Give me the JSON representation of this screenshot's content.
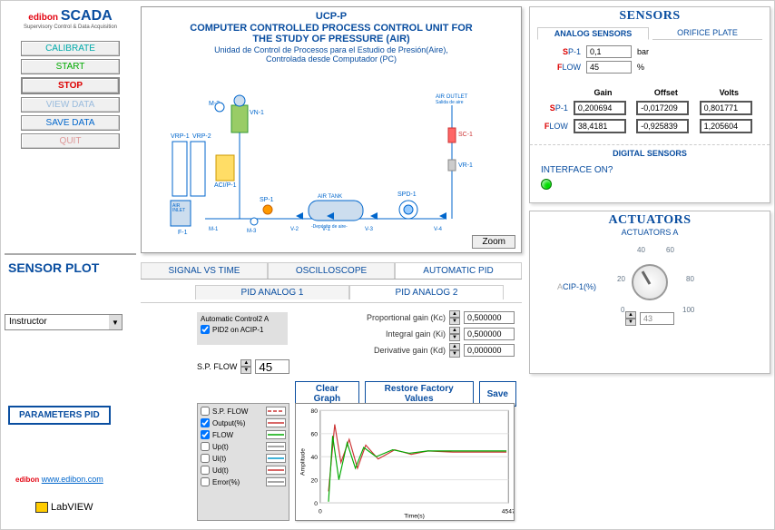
{
  "logo": {
    "prefix": "edibon",
    "main": "SCADA",
    "sub": "Supervisory Control & Data Acquisition"
  },
  "buttons": {
    "calibrate": "CALIBRATE",
    "start": "START",
    "stop": "STOP",
    "view": "VIEW DATA",
    "save": "SAVE DATA",
    "quit": "QUIT"
  },
  "sensor_plot_hdr": "SENSOR PLOT",
  "instructor": {
    "label": "Instructor"
  },
  "parameters_btn": "PARAMETERS PID",
  "website": {
    "prefix": "edibon",
    "url": "www.edibon.com"
  },
  "labview": "LabVIEW",
  "diagram": {
    "title1": "UCP-P",
    "title2": "COMPUTER CONTROLLED PROCESS CONTROL UNIT FOR",
    "title3": "THE STUDY OF PRESSURE (AIR)",
    "title4": "Unidad de Control de Procesos para el Estudio de Presión(Aire),",
    "title5": "Controlada desde Computador (PC)",
    "zoom": "Zoom",
    "labels": {
      "vrp1": "VRP-1",
      "vrp2": "VRP-2",
      "m2": "M-2",
      "vn1": "VN-1",
      "acip1": "ACI/P-1",
      "airinlet": "AIR\nINLET\nEntrada\nde Aire",
      "f1": "F-1",
      "m1": "M-1",
      "sp1": "SP-1",
      "m3": "M-3",
      "airtank": "AIR TANK\n-Depósito de aire-",
      "spd1": "SPD-1",
      "v1": "V-1",
      "v2": "V-2",
      "v3": "V-3",
      "v4": "V-4",
      "airoutlet": "AIR OUTLET\nSalida de aire",
      "sc1": "SC-1",
      "vr1": "VR-1"
    }
  },
  "mid_tabs": {
    "signal": "SIGNAL VS TIME",
    "osc": "OSCILLOSCOPE",
    "auto": "AUTOMATIC PID"
  },
  "sub_tabs": {
    "p1": "PID ANALOG 1",
    "p2": "PID ANALOG 2"
  },
  "auto_box": {
    "hdr": "Automatic Control2 A",
    "check": "PID2 on ACIP-1"
  },
  "sp_flow": {
    "label": "S.P. FLOW",
    "value": "45"
  },
  "gains": {
    "kc": {
      "label": "Proportional gain (Kc)",
      "value": "0,500000",
      "color": "#d00"
    },
    "ki": {
      "label": "Integral gain (Ki)",
      "value": "0,500000",
      "color": "#d00"
    },
    "kd": {
      "label": "Derivative gain (Kd)",
      "value": "0,000000",
      "color": "#d00"
    }
  },
  "pid_btns": {
    "clear": "Clear Graph",
    "restore": "Restore Factory Values",
    "save": "Save"
  },
  "legend": [
    {
      "name": "S.P. FLOW",
      "checked": false,
      "dash": "4,2",
      "color": "#c33"
    },
    {
      "name": "Output(%)",
      "checked": true,
      "dash": "",
      "color": "#c33"
    },
    {
      "name": "FLOW",
      "checked": true,
      "dash": "",
      "color": "#0a0"
    },
    {
      "name": "Up(t)",
      "checked": false,
      "dash": "",
      "color": "#888"
    },
    {
      "name": "Ui(t)",
      "checked": false,
      "dash": "",
      "color": "#09c"
    },
    {
      "name": "Ud(t)",
      "checked": false,
      "dash": "",
      "color": "#c33"
    },
    {
      "name": "Error(%)",
      "checked": false,
      "dash": "",
      "color": "#888"
    }
  ],
  "chart_data": {
    "type": "line",
    "title": "",
    "xlabel": "Time(s)",
    "ylabel": "Amplitude",
    "xlim": [
      0,
      4547
    ],
    "ylim": [
      0,
      80
    ],
    "xticks": [
      0,
      4547
    ],
    "yticks": [
      0,
      20,
      40,
      60,
      80
    ],
    "series": [
      {
        "name": "Output(%)",
        "color": "#c33",
        "x": [
          200,
          350,
          500,
          700,
          900,
          1100,
          1400,
          1800,
          2200,
          2600,
          3200,
          3800,
          4500
        ],
        "y": [
          10,
          68,
          35,
          55,
          30,
          50,
          38,
          46,
          42,
          45,
          44,
          44,
          44
        ]
      },
      {
        "name": "FLOW",
        "color": "#0a0",
        "x": [
          200,
          300,
          450,
          650,
          850,
          1050,
          1350,
          1750,
          2150,
          2600,
          3200,
          3800,
          4500
        ],
        "y": [
          1,
          58,
          20,
          52,
          30,
          48,
          40,
          46,
          43,
          45,
          45,
          45,
          45
        ]
      }
    ]
  },
  "sensors": {
    "header": "SENSORS",
    "tabs": {
      "analog": "ANALOG SENSORS",
      "orifice": "ORIFICE PLATE"
    },
    "rows": [
      {
        "label": "SP-1",
        "value": "0,1",
        "unit": "bar"
      },
      {
        "label": "FLOW",
        "value": "45",
        "unit": "%"
      }
    ],
    "cal": {
      "hdr": [
        "",
        "Gain",
        "Offset",
        "Volts"
      ],
      "rows": [
        {
          "label": "SP-1",
          "gain": "0,200694",
          "offset": "-0,017209",
          "volts": "0,801771"
        },
        {
          "label": "FLOW",
          "gain": "38,4181",
          "offset": "-0,925839",
          "volts": "1,205604"
        }
      ]
    },
    "digital_hdr": "DIGITAL SENSORS",
    "interface": "INTERFACE ON?"
  },
  "actuators": {
    "header": "ACTUATORS",
    "sub": "ACTUATORS A",
    "dial_label": "ACIP-1(%)",
    "ticks": [
      "0",
      "20",
      "40",
      "60",
      "80",
      "100"
    ],
    "value": "43"
  }
}
